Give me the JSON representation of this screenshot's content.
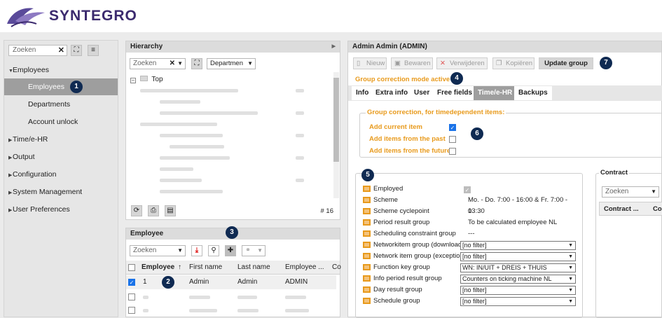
{
  "app": {
    "logo_text": "SYNTEGRO"
  },
  "sidebar": {
    "search_placeholder": "Zoeken",
    "items": [
      {
        "label": "Employees"
      },
      {
        "label": "Employees"
      },
      {
        "label": "Departments"
      },
      {
        "label": "Account unlock"
      },
      {
        "label": "Time/e-HR"
      },
      {
        "label": "Output"
      },
      {
        "label": "Configuration"
      },
      {
        "label": "System Management"
      },
      {
        "label": "User Preferences"
      }
    ]
  },
  "hierarchy": {
    "title": "Hierarchy",
    "search_placeholder": "Zoeken",
    "filter_value": "Departmen",
    "root_label": "Top",
    "count_label": "# 16"
  },
  "employee": {
    "title": "Employee",
    "search_placeholder": "Zoeken",
    "columns": [
      "Employee",
      "First name",
      "Last name",
      "Employee ...",
      "Co"
    ],
    "rows": [
      {
        "employee": "1",
        "first_name": "Admin",
        "last_name": "Admin",
        "code": "ADMIN"
      }
    ]
  },
  "detail": {
    "title": "Admin Admin (ADMIN)",
    "toolbar": {
      "new": "Nieuw",
      "save": "Bewaren",
      "delete": "Verwijderen",
      "copy": "Kopiëren",
      "update_group": "Update group"
    },
    "group_mode_text": "Group correction mode active",
    "tabs": [
      "Info",
      "Extra info",
      "User",
      "Free fields",
      "Time/e-HR",
      "Backups"
    ],
    "active_tab": "Time/e-HR",
    "group_correction": {
      "legend": "Group correction, for timedependent items:",
      "options": [
        {
          "label": "Add current item",
          "checked": true
        },
        {
          "label": "Add items from the past",
          "checked": false
        },
        {
          "label": "Add items from the future",
          "checked": false
        }
      ]
    },
    "fields": {
      "employed": "Employed",
      "scheme": "Scheme",
      "scheme_value": "Mo. - Do. 7:00 - 16:00 & Fr. 7:00 - 13:30",
      "scheme_cyclepoint": "Scheme cyclepoint",
      "scheme_cyclepoint_value": "0",
      "period_result_group": "Period result group",
      "period_result_group_value": "To be calculated employee NL",
      "scheduling_constraint_group": "Scheduling constraint group",
      "scheduling_constraint_group_value": "---",
      "networkitem_download": "Networkitem group (download)",
      "networkitem_download_value": "[no filter]",
      "network_exception": "Network item group (exception)",
      "network_exception_value": "[no filter]",
      "function_key_group": "Function key group",
      "function_key_group_value": "WN: IN/UIT + DREIS + THUIS",
      "info_period_result_group": "Info period result group",
      "info_period_result_group_value": "Counters on ticking machine NL",
      "day_result_group": "Day result group",
      "day_result_group_value": "[no filter]",
      "schedule_group": "Schedule group",
      "schedule_group_value": "[no filter]"
    },
    "contract": {
      "legend": "Contract",
      "search_placeholder": "Zoeken",
      "columns": [
        "Contract ...",
        "Co"
      ]
    }
  },
  "callouts": [
    "1",
    "2",
    "3",
    "4",
    "5",
    "6",
    "7"
  ],
  "colors": {
    "brand": "#3b2a6e",
    "accent_orange": "#e89a1c",
    "callout": "#0f2a52",
    "selected": "#9e9e9e"
  }
}
